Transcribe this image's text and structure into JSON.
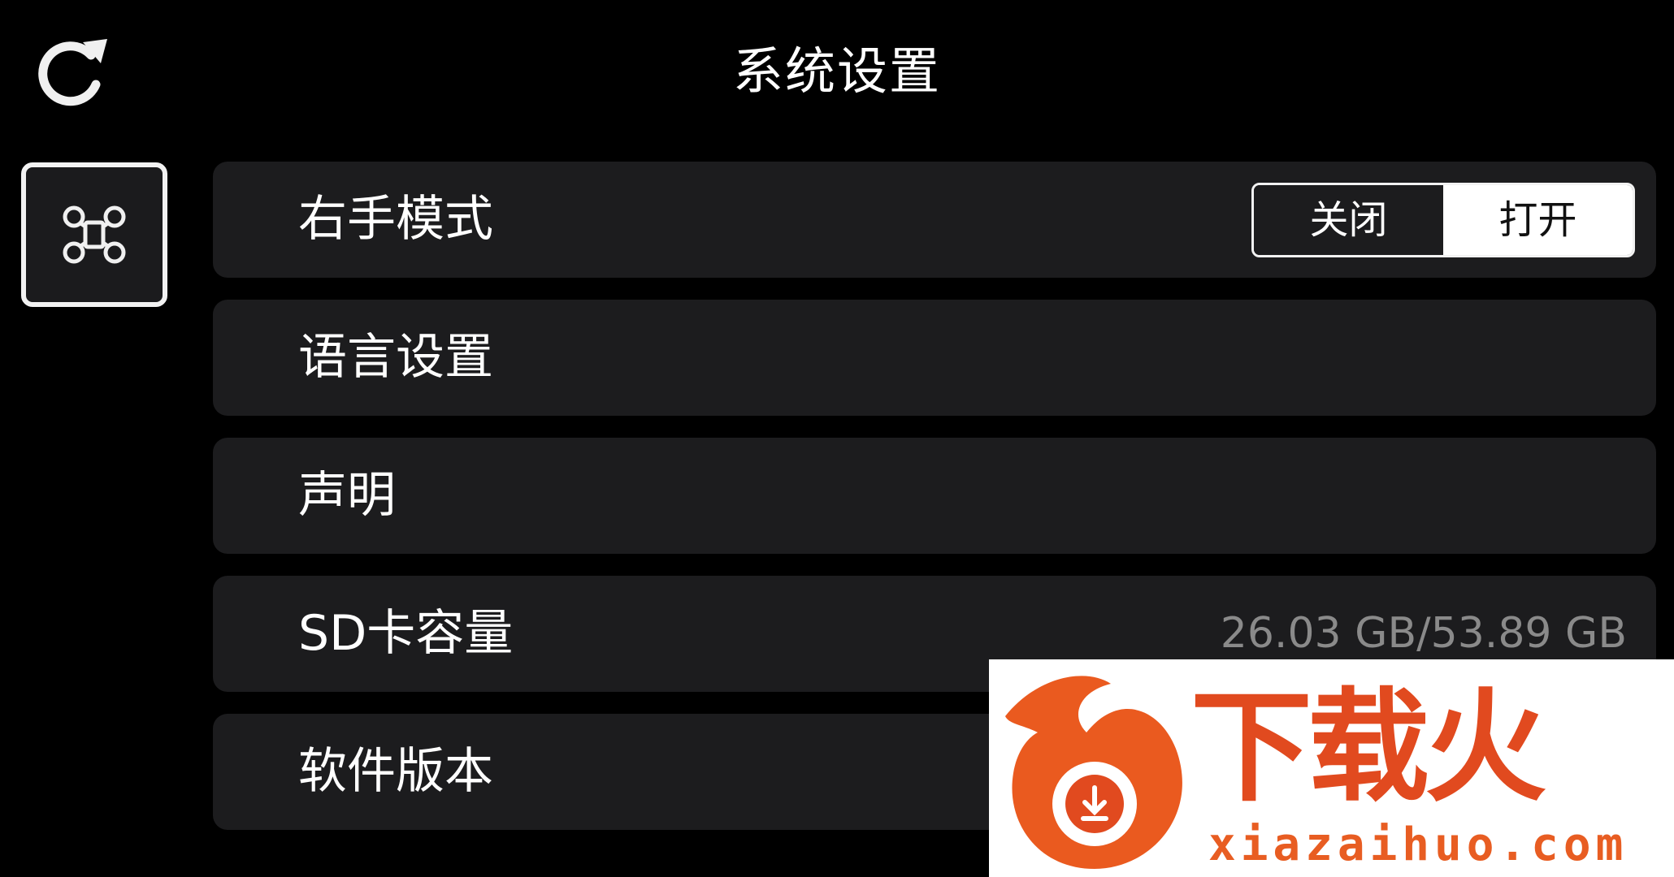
{
  "header": {
    "title": "系统设置",
    "refresh_icon": "refresh-icon"
  },
  "side_nav": {
    "icon": "drone-icon",
    "selected": true
  },
  "settings": {
    "right_hand_mode": {
      "label": "右手模式",
      "toggle": {
        "off_label": "关闭",
        "on_label": "打开",
        "selected": "打开"
      }
    },
    "language": {
      "label": "语言设置"
    },
    "statement": {
      "label": "声明"
    },
    "sd_card": {
      "label": "SD卡容量",
      "value": "26.03 GB/53.89 GB"
    },
    "software_version": {
      "label": "软件版本"
    }
  },
  "watermark": {
    "brand": "下载火",
    "url": "xiazaihuo.com"
  },
  "colors": {
    "background": "#000000",
    "row_background": "#1c1c1e",
    "text": "#ffffff",
    "secondary_text": "#8a8a8a",
    "watermark_orange": "#e14a1f"
  }
}
